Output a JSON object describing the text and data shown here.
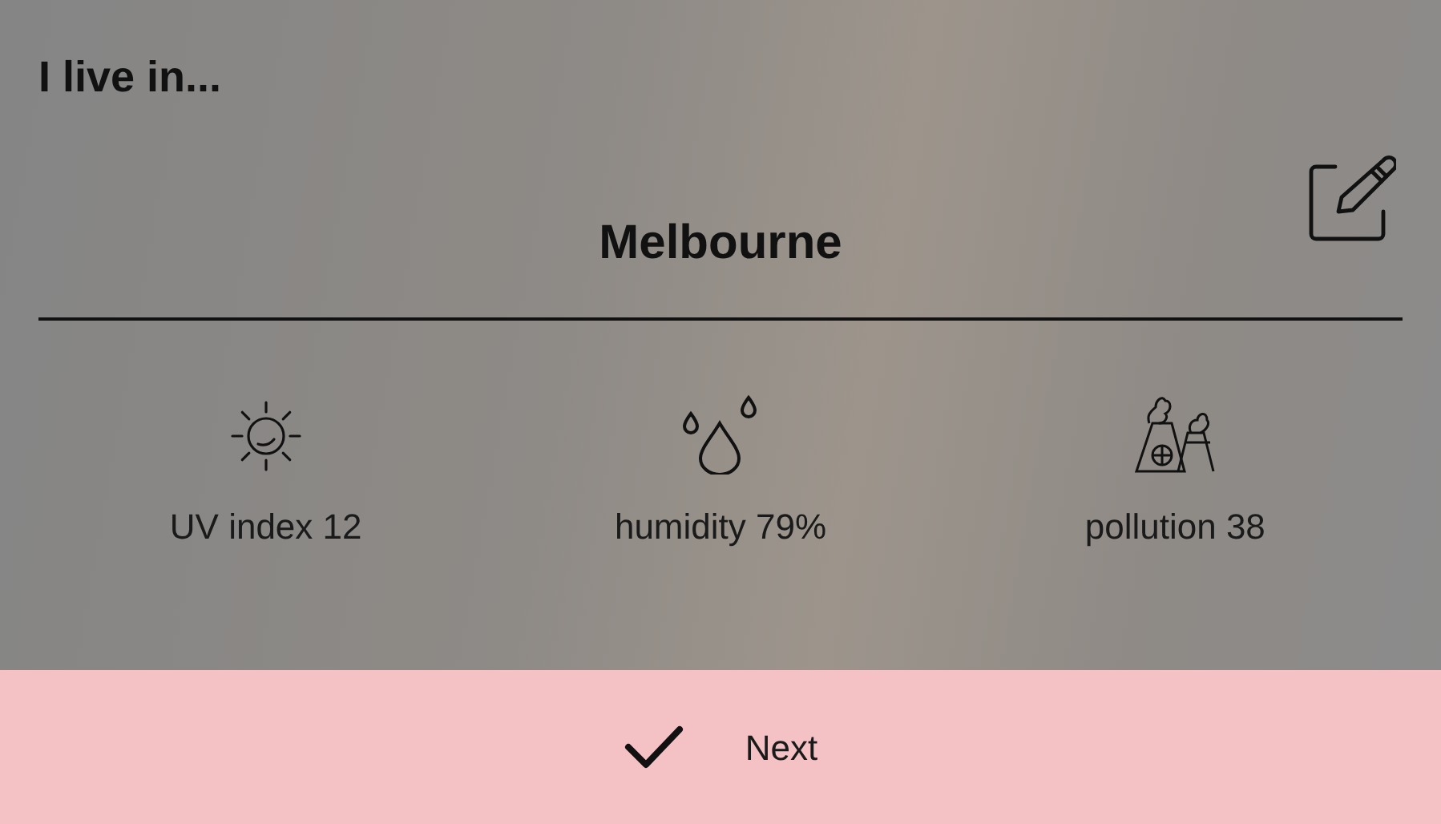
{
  "heading": "I live in...",
  "city": {
    "value": "Melbourne"
  },
  "stats": [
    {
      "kind": "uv",
      "label": "UV index 12"
    },
    {
      "kind": "humidity",
      "label": "humidity 79%"
    },
    {
      "kind": "pollution",
      "label": "pollution 38"
    }
  ],
  "next_button": {
    "label": "Next"
  }
}
